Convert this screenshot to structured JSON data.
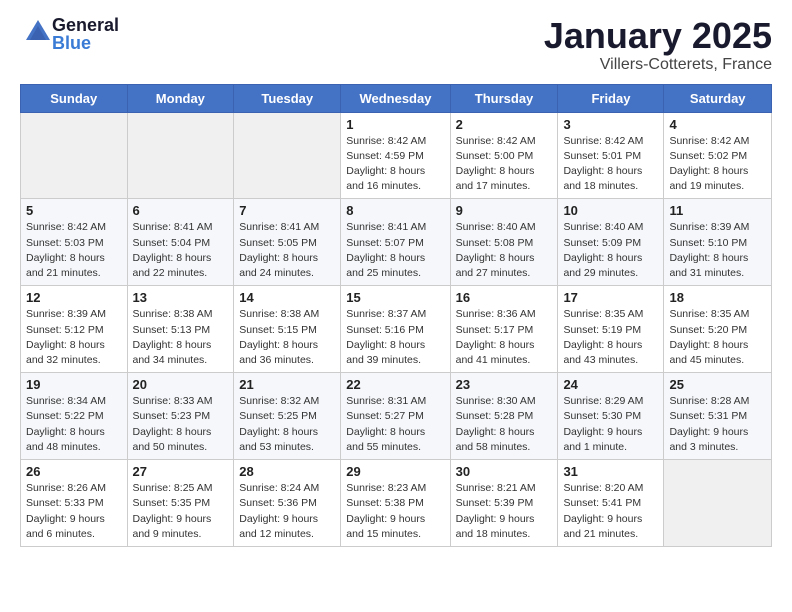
{
  "logo": {
    "general": "General",
    "blue": "Blue"
  },
  "title": "January 2025",
  "location": "Villers-Cotterets, France",
  "days_of_week": [
    "Sunday",
    "Monday",
    "Tuesday",
    "Wednesday",
    "Thursday",
    "Friday",
    "Saturday"
  ],
  "weeks": [
    [
      {
        "day": "",
        "info": ""
      },
      {
        "day": "",
        "info": ""
      },
      {
        "day": "",
        "info": ""
      },
      {
        "day": "1",
        "info": "Sunrise: 8:42 AM\nSunset: 4:59 PM\nDaylight: 8 hours\nand 16 minutes."
      },
      {
        "day": "2",
        "info": "Sunrise: 8:42 AM\nSunset: 5:00 PM\nDaylight: 8 hours\nand 17 minutes."
      },
      {
        "day": "3",
        "info": "Sunrise: 8:42 AM\nSunset: 5:01 PM\nDaylight: 8 hours\nand 18 minutes."
      },
      {
        "day": "4",
        "info": "Sunrise: 8:42 AM\nSunset: 5:02 PM\nDaylight: 8 hours\nand 19 minutes."
      }
    ],
    [
      {
        "day": "5",
        "info": "Sunrise: 8:42 AM\nSunset: 5:03 PM\nDaylight: 8 hours\nand 21 minutes."
      },
      {
        "day": "6",
        "info": "Sunrise: 8:41 AM\nSunset: 5:04 PM\nDaylight: 8 hours\nand 22 minutes."
      },
      {
        "day": "7",
        "info": "Sunrise: 8:41 AM\nSunset: 5:05 PM\nDaylight: 8 hours\nand 24 minutes."
      },
      {
        "day": "8",
        "info": "Sunrise: 8:41 AM\nSunset: 5:07 PM\nDaylight: 8 hours\nand 25 minutes."
      },
      {
        "day": "9",
        "info": "Sunrise: 8:40 AM\nSunset: 5:08 PM\nDaylight: 8 hours\nand 27 minutes."
      },
      {
        "day": "10",
        "info": "Sunrise: 8:40 AM\nSunset: 5:09 PM\nDaylight: 8 hours\nand 29 minutes."
      },
      {
        "day": "11",
        "info": "Sunrise: 8:39 AM\nSunset: 5:10 PM\nDaylight: 8 hours\nand 31 minutes."
      }
    ],
    [
      {
        "day": "12",
        "info": "Sunrise: 8:39 AM\nSunset: 5:12 PM\nDaylight: 8 hours\nand 32 minutes."
      },
      {
        "day": "13",
        "info": "Sunrise: 8:38 AM\nSunset: 5:13 PM\nDaylight: 8 hours\nand 34 minutes."
      },
      {
        "day": "14",
        "info": "Sunrise: 8:38 AM\nSunset: 5:15 PM\nDaylight: 8 hours\nand 36 minutes."
      },
      {
        "day": "15",
        "info": "Sunrise: 8:37 AM\nSunset: 5:16 PM\nDaylight: 8 hours\nand 39 minutes."
      },
      {
        "day": "16",
        "info": "Sunrise: 8:36 AM\nSunset: 5:17 PM\nDaylight: 8 hours\nand 41 minutes."
      },
      {
        "day": "17",
        "info": "Sunrise: 8:35 AM\nSunset: 5:19 PM\nDaylight: 8 hours\nand 43 minutes."
      },
      {
        "day": "18",
        "info": "Sunrise: 8:35 AM\nSunset: 5:20 PM\nDaylight: 8 hours\nand 45 minutes."
      }
    ],
    [
      {
        "day": "19",
        "info": "Sunrise: 8:34 AM\nSunset: 5:22 PM\nDaylight: 8 hours\nand 48 minutes."
      },
      {
        "day": "20",
        "info": "Sunrise: 8:33 AM\nSunset: 5:23 PM\nDaylight: 8 hours\nand 50 minutes."
      },
      {
        "day": "21",
        "info": "Sunrise: 8:32 AM\nSunset: 5:25 PM\nDaylight: 8 hours\nand 53 minutes."
      },
      {
        "day": "22",
        "info": "Sunrise: 8:31 AM\nSunset: 5:27 PM\nDaylight: 8 hours\nand 55 minutes."
      },
      {
        "day": "23",
        "info": "Sunrise: 8:30 AM\nSunset: 5:28 PM\nDaylight: 8 hours\nand 58 minutes."
      },
      {
        "day": "24",
        "info": "Sunrise: 8:29 AM\nSunset: 5:30 PM\nDaylight: 9 hours\nand 1 minute."
      },
      {
        "day": "25",
        "info": "Sunrise: 8:28 AM\nSunset: 5:31 PM\nDaylight: 9 hours\nand 3 minutes."
      }
    ],
    [
      {
        "day": "26",
        "info": "Sunrise: 8:26 AM\nSunset: 5:33 PM\nDaylight: 9 hours\nand 6 minutes."
      },
      {
        "day": "27",
        "info": "Sunrise: 8:25 AM\nSunset: 5:35 PM\nDaylight: 9 hours\nand 9 minutes."
      },
      {
        "day": "28",
        "info": "Sunrise: 8:24 AM\nSunset: 5:36 PM\nDaylight: 9 hours\nand 12 minutes."
      },
      {
        "day": "29",
        "info": "Sunrise: 8:23 AM\nSunset: 5:38 PM\nDaylight: 9 hours\nand 15 minutes."
      },
      {
        "day": "30",
        "info": "Sunrise: 8:21 AM\nSunset: 5:39 PM\nDaylight: 9 hours\nand 18 minutes."
      },
      {
        "day": "31",
        "info": "Sunrise: 8:20 AM\nSunset: 5:41 PM\nDaylight: 9 hours\nand 21 minutes."
      },
      {
        "day": "",
        "info": ""
      }
    ]
  ]
}
